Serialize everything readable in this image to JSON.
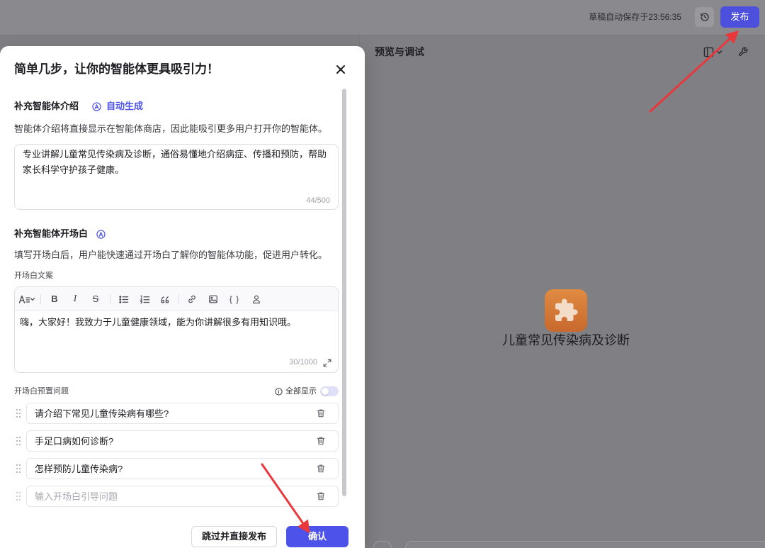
{
  "header": {
    "autosave_text": "草稿自动保存于23:56:35",
    "history_icon": "history-icon",
    "publish_label": "发布"
  },
  "preview": {
    "title": "预览与调试",
    "layout_icon": "layout-icon",
    "settings_icon": "wrench-icon",
    "agent_icon": "puzzle-icon",
    "agent_name": "儿童常见传染病及诊断"
  },
  "modal": {
    "title": "简单几步，让你的智能体更具吸引力！",
    "close_icon": "close-icon",
    "intro": {
      "heading": "补充智能体介绍",
      "auto_generate_icon": "auto-generate-icon",
      "auto_generate_label": "自动生成",
      "description": "智能体介绍将直接显示在智能体商店，因此能吸引更多用户打开你的智能体。",
      "value": "专业讲解儿童常见传染病及诊断，通俗易懂地介绍病症、传播和预防，帮助家长科学守护孩子健康。",
      "counter": "44/500"
    },
    "opening": {
      "heading": "补充智能体开场白",
      "auto_generate_icon": "auto-generate-icon",
      "description": "填写开场白后，用户能快速通过开场白了解你的智能体功能，促进用户转化。",
      "copy_label": "开场白文案",
      "toolbar_icons": [
        "font-size-icon",
        "chevron-down-icon",
        "bold-icon",
        "italic-icon",
        "strikethrough-icon",
        "bullet-list-icon",
        "numbered-list-icon",
        "quote-icon",
        "link-icon",
        "image-icon",
        "code-braces-icon",
        "mention-icon"
      ],
      "toolbar_glyphs": {
        "bold": "B",
        "italic": "I",
        "strike": "S",
        "braces": "{ }"
      },
      "value": "嗨，大家好！我致力于儿童健康领域，能为你讲解很多有用知识哦。",
      "counter": "30/1000",
      "expand_icon": "expand-icon"
    },
    "questions": {
      "label": "开场白预置问题",
      "info_icon": "info-icon",
      "show_all_label": "全部显示",
      "show_all_enabled": false,
      "items": [
        "请介绍下常见儿童传染病有哪些?",
        "手足口病如何诊断?",
        "怎样预防儿童传染病?"
      ],
      "placeholder": "输入开场白引导问题",
      "drag_icon": "drag-handle-icon",
      "delete_icon": "trash-icon"
    },
    "footer": {
      "skip_label": "跳过并直接发布",
      "confirm_label": "确认"
    }
  },
  "colors": {
    "accent": "#4d53e8",
    "agent_icon": "#d97b35",
    "annotation_arrow": "#e8383c"
  }
}
